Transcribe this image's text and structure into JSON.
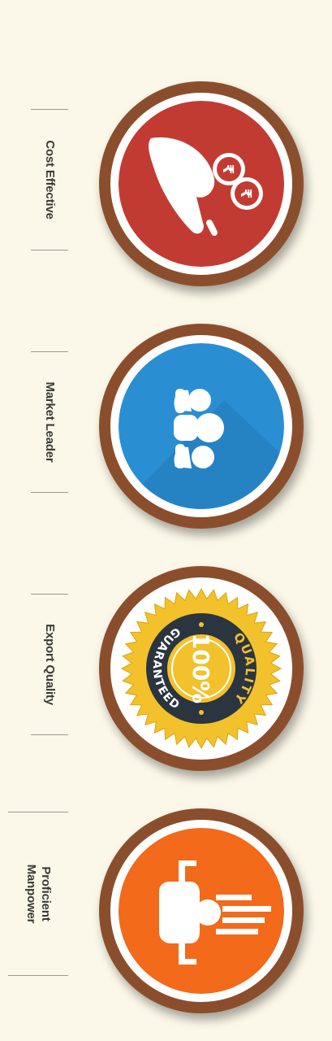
{
  "features": [
    {
      "label": "Cost Effective",
      "icon": "hand-coins-icon",
      "color": "#c23b32"
    },
    {
      "label": "Market Leader",
      "icon": "leader-people-icon",
      "color": "#2a8ed3"
    },
    {
      "label": "Export Quality",
      "icon": "quality-seal-icon",
      "color": "#f2c12b",
      "seal": {
        "top_text": "QUALITY",
        "bottom_text": "GUARANTEED",
        "center_text": "100%"
      }
    },
    {
      "label": "Proficient\nManpower",
      "icon": "presenter-icon",
      "color": "#f26a1a"
    }
  ]
}
